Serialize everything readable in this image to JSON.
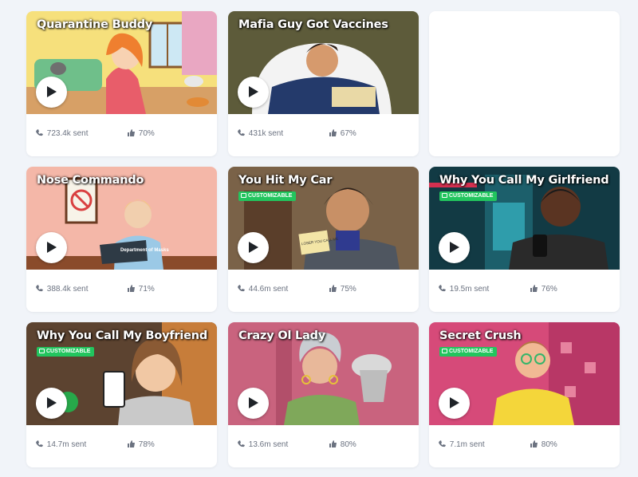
{
  "cards": [
    {
      "title": "Quarantine Buddy",
      "customizable": false,
      "sent": "723.4k sent",
      "like": "70%"
    },
    {
      "title": "Mafia Guy Got Vaccines",
      "customizable": false,
      "sent": "431k sent",
      "like": "67%"
    },
    {
      "title": "Nose Commando",
      "customizable": false,
      "sent": "388.4k sent",
      "like": "71%"
    },
    {
      "title": "You Hit My Car",
      "customizable": true,
      "sent": "44.6m sent",
      "like": "75%"
    },
    {
      "title": "Why You Call My Girlfriend",
      "customizable": true,
      "sent": "19.5m sent",
      "like": "76%"
    },
    {
      "title": "Why You Call My Boyfriend",
      "customizable": true,
      "sent": "14.7m sent",
      "like": "78%"
    },
    {
      "title": "Crazy Ol Lady",
      "customizable": false,
      "sent": "13.6m sent",
      "like": "80%"
    },
    {
      "title": "Secret Crush",
      "customizable": true,
      "sent": "7.1m sent",
      "like": "80%"
    }
  ],
  "badge_label": "CUSTOMIZABLE",
  "illustration_text": {
    "department_sign": "Department of Masks",
    "note_text": "LOSER YOU CALL ME"
  },
  "colors": {
    "badge": "#22c55e",
    "page_bg": "#f1f4f9",
    "muted_text": "#6b7280"
  },
  "icons": {
    "play": "play-icon",
    "phone": "phone-icon",
    "like": "thumbs-up-icon",
    "badge": "customizable-icon"
  }
}
